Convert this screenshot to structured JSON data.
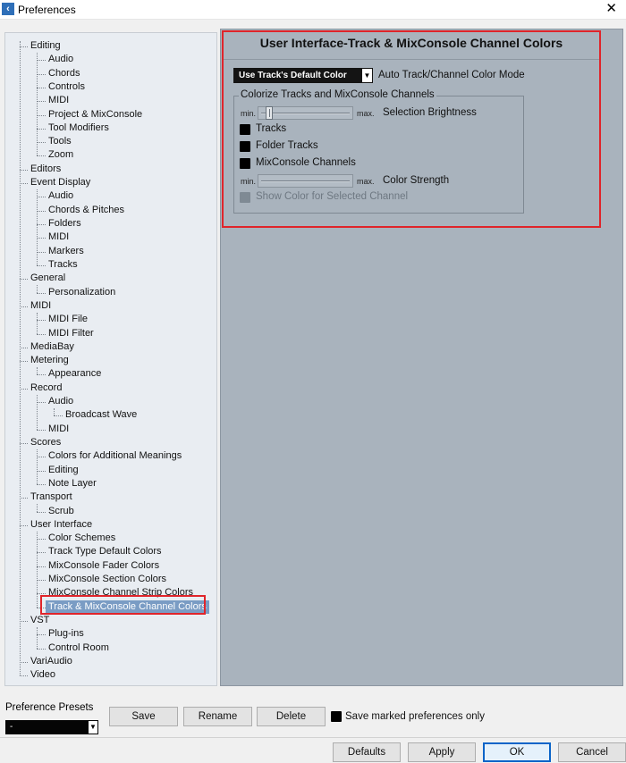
{
  "window": {
    "title": "Preferences",
    "close": "✕"
  },
  "tree": [
    {
      "label": "Editing",
      "level": 0
    },
    {
      "label": "Audio",
      "level": 1
    },
    {
      "label": "Chords",
      "level": 1
    },
    {
      "label": "Controls",
      "level": 1
    },
    {
      "label": "MIDI",
      "level": 1
    },
    {
      "label": "Project & MixConsole",
      "level": 1
    },
    {
      "label": "Tool Modifiers",
      "level": 1
    },
    {
      "label": "Tools",
      "level": 1
    },
    {
      "label": "Zoom",
      "level": 1
    },
    {
      "label": "Editors",
      "level": 0
    },
    {
      "label": "Event Display",
      "level": 0
    },
    {
      "label": "Audio",
      "level": 1
    },
    {
      "label": "Chords & Pitches",
      "level": 1
    },
    {
      "label": "Folders",
      "level": 1
    },
    {
      "label": "MIDI",
      "level": 1
    },
    {
      "label": "Markers",
      "level": 1
    },
    {
      "label": "Tracks",
      "level": 1
    },
    {
      "label": "General",
      "level": 0
    },
    {
      "label": "Personalization",
      "level": 1
    },
    {
      "label": "MIDI",
      "level": 0
    },
    {
      "label": "MIDI File",
      "level": 1
    },
    {
      "label": "MIDI Filter",
      "level": 1
    },
    {
      "label": "MediaBay",
      "level": 0
    },
    {
      "label": "Metering",
      "level": 0
    },
    {
      "label": "Appearance",
      "level": 1
    },
    {
      "label": "Record",
      "level": 0
    },
    {
      "label": "Audio",
      "level": 1
    },
    {
      "label": "Broadcast Wave",
      "level": 2
    },
    {
      "label": "MIDI",
      "level": 1
    },
    {
      "label": "Scores",
      "level": 0
    },
    {
      "label": "Colors for Additional Meanings",
      "level": 1
    },
    {
      "label": "Editing",
      "level": 1
    },
    {
      "label": "Note Layer",
      "level": 1
    },
    {
      "label": "Transport",
      "level": 0
    },
    {
      "label": "Scrub",
      "level": 1
    },
    {
      "label": "User Interface",
      "level": 0
    },
    {
      "label": "Color Schemes",
      "level": 1
    },
    {
      "label": "Track Type Default Colors",
      "level": 1
    },
    {
      "label": "MixConsole Fader Colors",
      "level": 1
    },
    {
      "label": "MixConsole Section Colors",
      "level": 1
    },
    {
      "label": "MixConsole Channel Strip Colors",
      "level": 1
    },
    {
      "label": "Track & MixConsole Channel Colors",
      "level": 1,
      "selected": true
    },
    {
      "label": "VST",
      "level": 0
    },
    {
      "label": "Plug-ins",
      "level": 1
    },
    {
      "label": "Control Room",
      "level": 1
    },
    {
      "label": "VariAudio",
      "level": 0
    },
    {
      "label": "Video",
      "level": 0
    }
  ],
  "content": {
    "title": "User Interface-Track & MixConsole Channel Colors",
    "mode_select_value": "Use Track's Default Color",
    "mode_label": "Auto Track/Channel Color Mode",
    "group_label": "Colorize Tracks and MixConsole Channels",
    "brightness": {
      "min": "min.",
      "max": "max.",
      "label": "Selection Brightness",
      "level": 0.1
    },
    "checks": {
      "tracks": "Tracks",
      "folder_tracks": "Folder Tracks",
      "mixconsole_channels": "MixConsole Channels"
    },
    "strength": {
      "min": "min.",
      "max": "max.",
      "label": "Color Strength"
    },
    "show_selected": "Show Color for Selected Channel"
  },
  "footer": {
    "presets_label": "Preference Presets",
    "presets_value": "-",
    "save": "Save",
    "rename": "Rename",
    "delete": "Delete",
    "save_marked": "Save marked preferences only",
    "defaults": "Defaults",
    "apply": "Apply",
    "ok": "OK",
    "cancel": "Cancel"
  }
}
